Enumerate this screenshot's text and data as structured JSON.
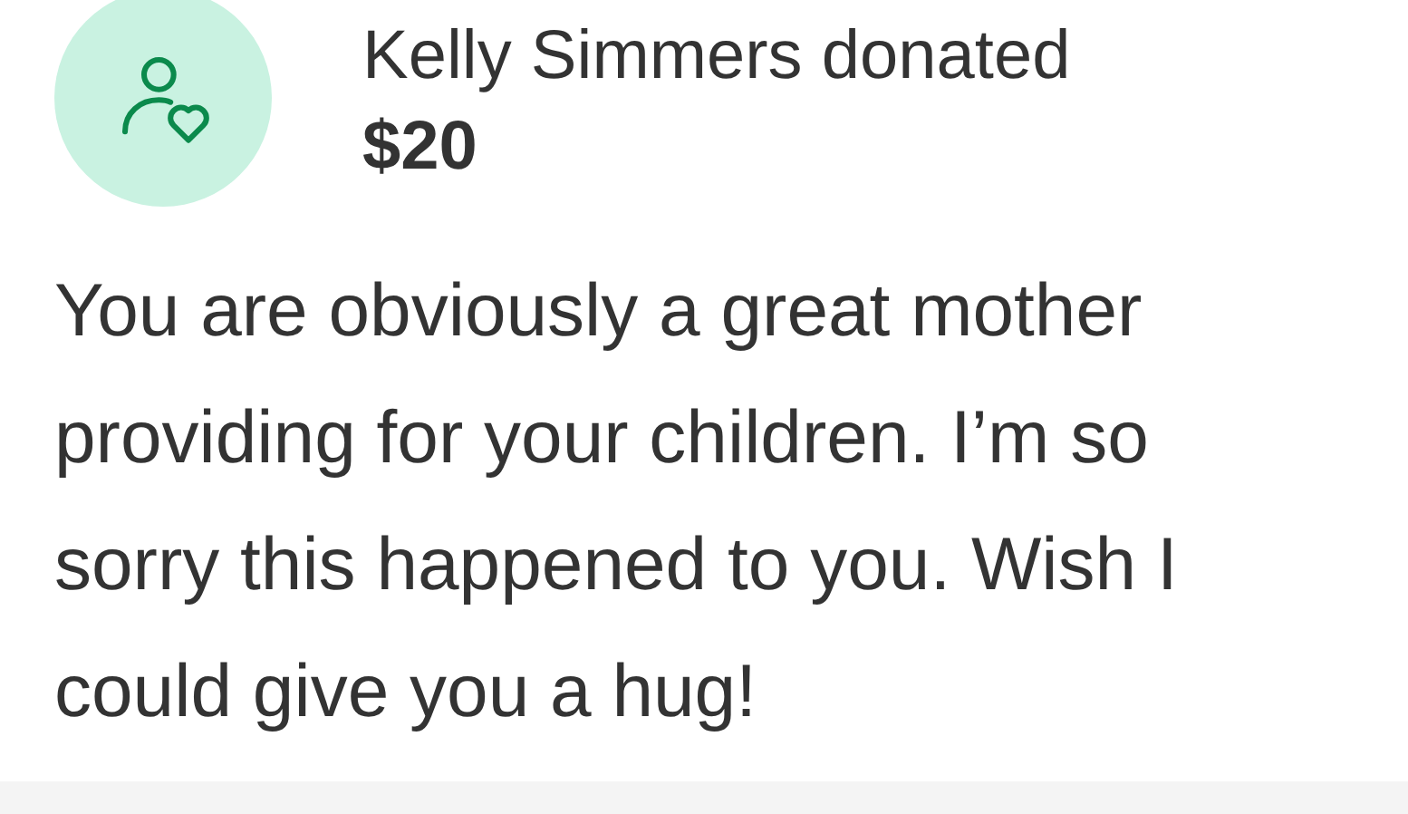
{
  "donation": {
    "donor_line": "Kelly Simmers donated",
    "amount": "$20",
    "message": "You are obviously a great mother providing for your children. I’m so sorry this happened to you. Wish I could give you a hug!"
  }
}
